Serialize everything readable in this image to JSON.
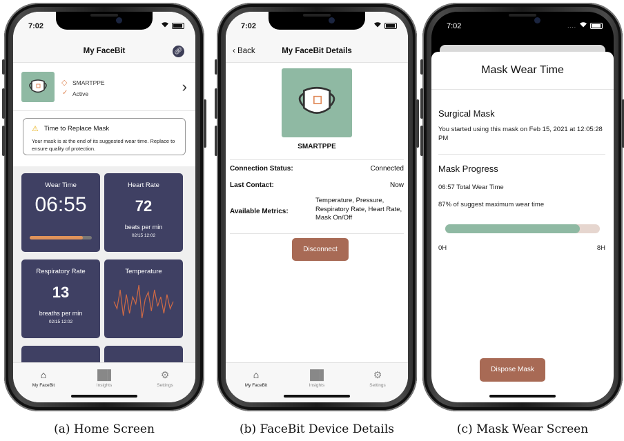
{
  "status_time": "7:02",
  "status_dots": "....",
  "screen1": {
    "nav_title": "My FaceBit",
    "device": {
      "name": "SMARTPPE",
      "status": "Active"
    },
    "alert": {
      "title": "Time to Replace Mask",
      "body": "Your mask is at the end of its suggested wear time. Replace to ensure quality of protection."
    },
    "tiles": {
      "wear_time": {
        "title": "Wear Time",
        "value": "06:55",
        "progress": 0.86
      },
      "heart_rate": {
        "title": "Heart Rate",
        "value": "72",
        "unit": "beats per min",
        "date": "02/15 12:02"
      },
      "respiratory_rate": {
        "title": "Respiratory Rate",
        "value": "13",
        "unit": "breaths per min",
        "date": "02/15 12:02"
      },
      "temperature": {
        "title": "Temperature"
      }
    },
    "sparkline": [
      20,
      14,
      30,
      8,
      26,
      10,
      24,
      18,
      34,
      6,
      22,
      28,
      12,
      30,
      16,
      24,
      10,
      26,
      14,
      20
    ]
  },
  "tabs": [
    {
      "label": "My FaceBit",
      "icon": "home-icon"
    },
    {
      "label": "Insights",
      "icon": "bar-chart-icon"
    },
    {
      "label": "Settings",
      "icon": "gear-icon"
    }
  ],
  "screen2": {
    "back_label": "Back",
    "nav_title": "My FaceBit Details",
    "device_name": "SMARTPPE",
    "rows": [
      {
        "label": "Connection Status:",
        "value": "Connected"
      },
      {
        "label": "Last Contact:",
        "value": "Now"
      },
      {
        "label": "Available Metrics:",
        "value": "Temperature, Pressure, Respiratory Rate, Heart Rate, Mask On/Off"
      }
    ],
    "disconnect_label": "Disconnect"
  },
  "screen3": {
    "title": "Mask Wear Time",
    "mask_type": "Surgical Mask",
    "started_text": "You started using this mask on Feb 15, 2021 at 12:05:28 PM",
    "progress_heading": "Mask Progress",
    "total_wear": "06:57 Total Wear Time",
    "percent_text": "87% of suggest maximum wear time",
    "progress": 0.87,
    "axis_start": "0H",
    "axis_end": "8H",
    "dispose_label": "Dispose Mask"
  },
  "captions": [
    "(a) Home Screen",
    "(b) FaceBit Device Details",
    "(c) Mask Wear Screen"
  ],
  "colors": {
    "tile": "#3f4063",
    "mask_green": "#8fb9a3",
    "accent_orange": "#e0935a",
    "button_brown": "#a86a55"
  }
}
